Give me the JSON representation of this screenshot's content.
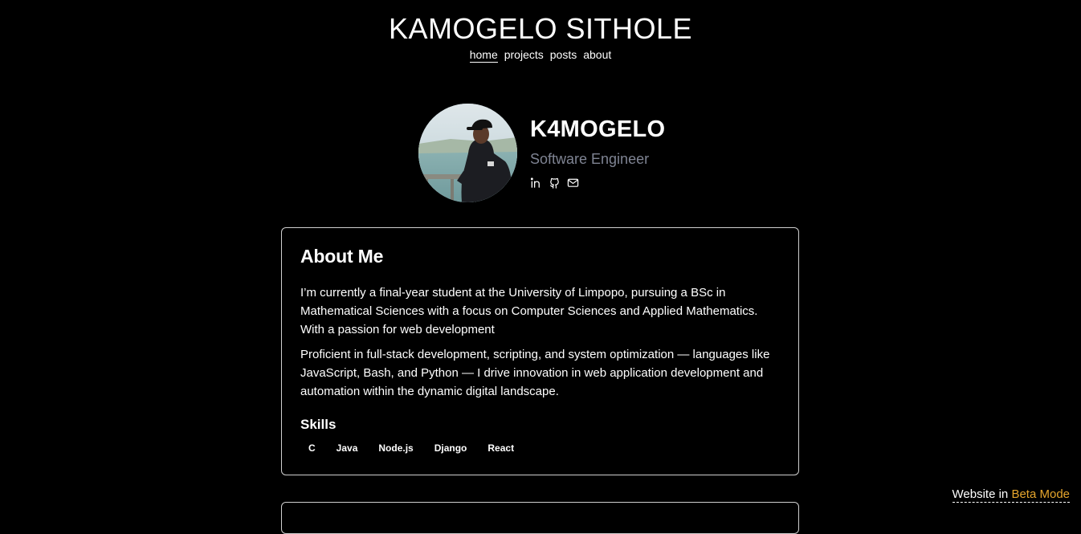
{
  "site": {
    "title": "KAMOGELO SITHOLE"
  },
  "nav": {
    "items": [
      {
        "label": "home",
        "active": true
      },
      {
        "label": "projects",
        "active": false
      },
      {
        "label": "posts",
        "active": false
      },
      {
        "label": "about",
        "active": false
      }
    ]
  },
  "profile": {
    "name": "K4MOGELO",
    "role": "Software Engineer",
    "socials": [
      {
        "icon": "linkedin-icon"
      },
      {
        "icon": "github-icon"
      },
      {
        "icon": "mail-icon"
      }
    ]
  },
  "about": {
    "heading": "About Me",
    "paragraph1": "I’m currently a final-year student at the University of Limpopo, pursuing a BSc in Mathematical Sciences with a focus on Computer Sciences and Applied Mathematics. With a passion for web development",
    "paragraph2": "Proficient in full-stack development, scripting, and system optimization — languages like JavaScript, Bash, and Python — I drive innovation in web application development and automation within the dynamic digital landscape.",
    "skills_heading": "Skills",
    "skills": [
      "C",
      "Java",
      "Node.js",
      "Django",
      "React"
    ]
  },
  "beta": {
    "prefix": "Website in ",
    "accent": "Beta Mode",
    "accent_color": "#e5a52c"
  }
}
